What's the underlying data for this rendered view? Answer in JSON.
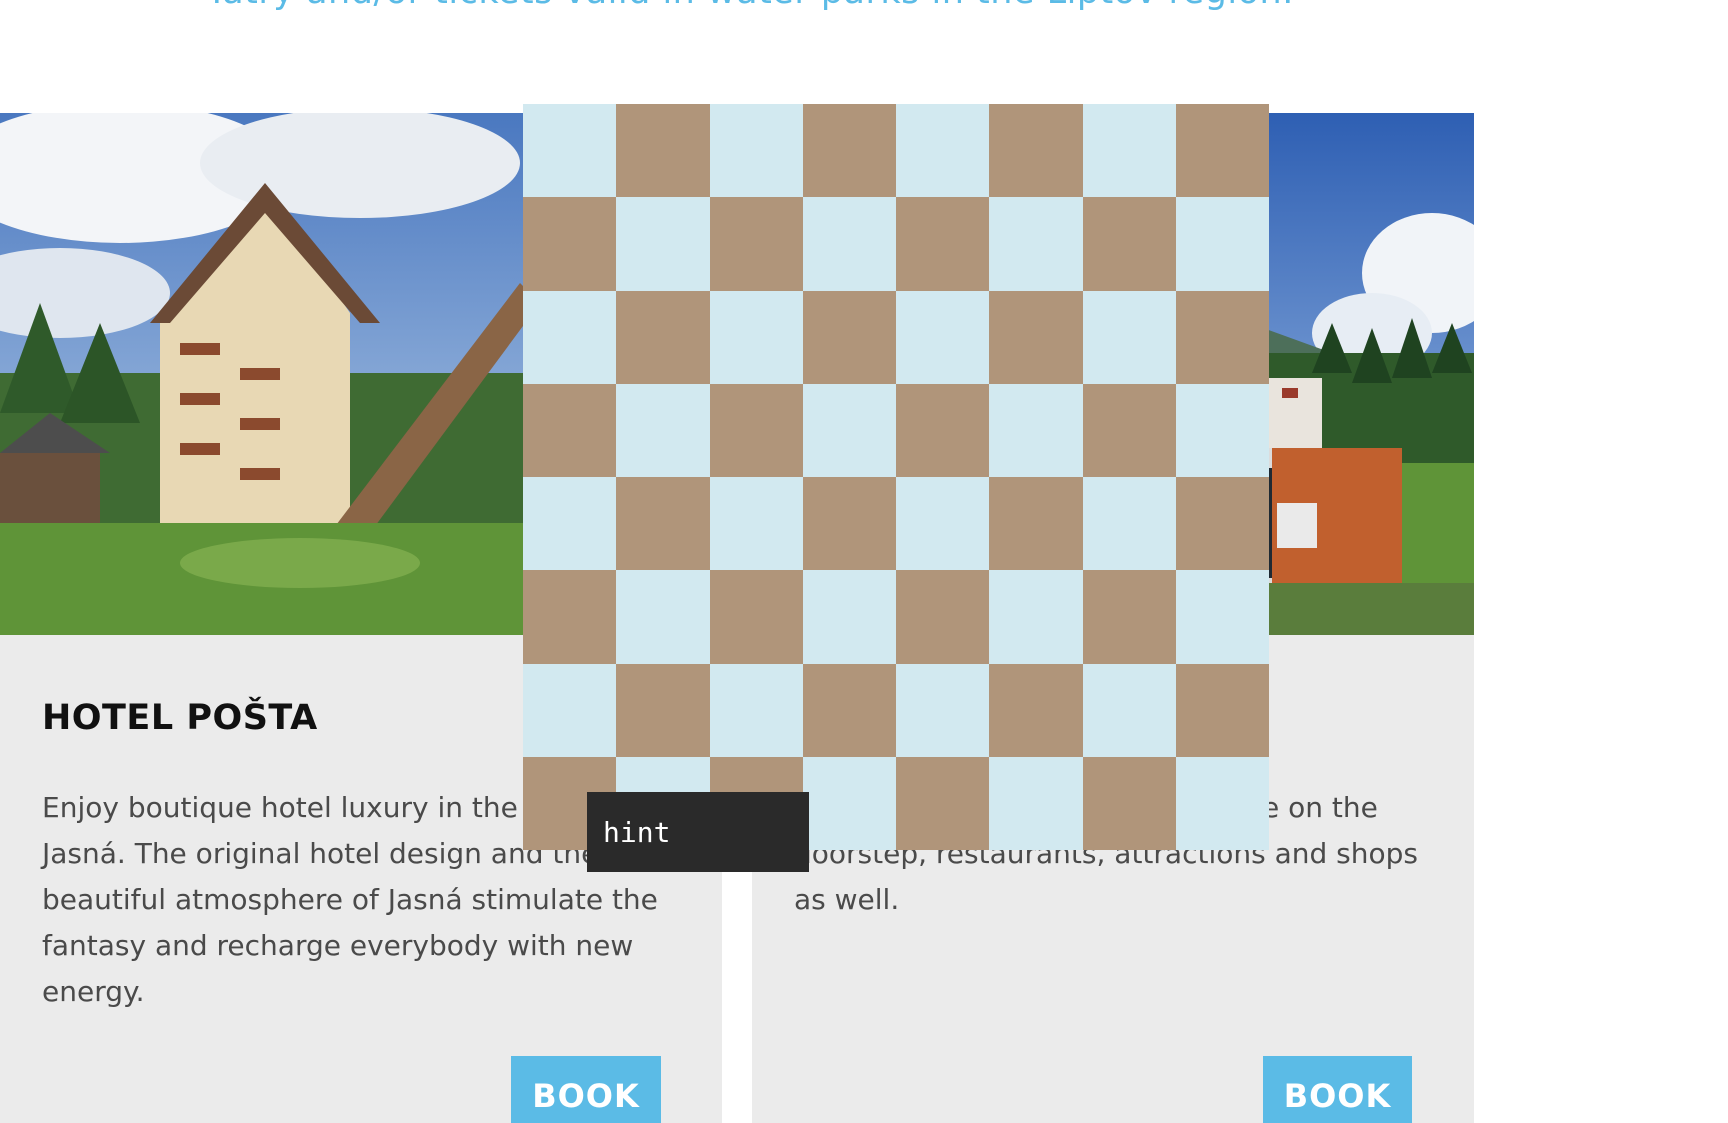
{
  "intro_text": "Tatry and/or tickets valid in water parks in the Liptov region.",
  "cards": [
    {
      "title": "HOTEL POŠTA",
      "description": "Enjoy boutique hotel luxury in the heart of Jasná. The original hotel design and the beautiful atmosphere of Jasná stimulate the fantasy and recharge everybody with new energy.",
      "button_label": "BOOK"
    },
    {
      "title": "",
      "description": "…ne heart of Jasna. Cable cars are on the doorstep, restaurants, attractions and shops as well.",
      "button_label": "BOOK"
    }
  ],
  "board": {
    "size": 8,
    "light_color": "#d2e9f0",
    "dark_color": "#b0957a"
  },
  "hint_label": "hint",
  "colors": {
    "accent": "#5bbbe6",
    "card_bg": "#ebebeb",
    "hint_bg": "#2a2a2a"
  }
}
